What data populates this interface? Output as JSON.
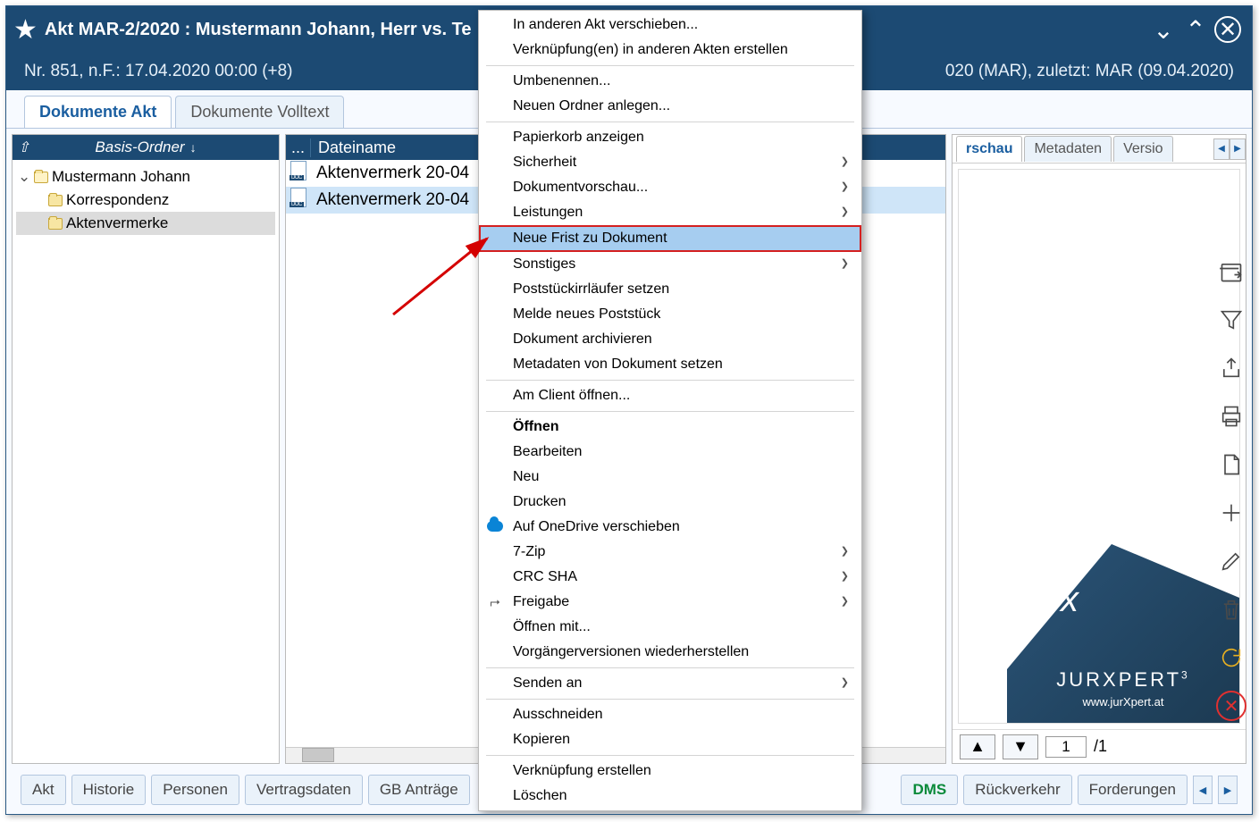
{
  "titlebar": {
    "title": "Akt MAR-2/2020 : Mustermann Johann, Herr vs. Te"
  },
  "subheader": {
    "left": "Nr. 851, n.F.: 17.04.2020 00:00 (+8)",
    "right": "020 (MAR), zuletzt: MAR (09.04.2020)"
  },
  "tabs": {
    "akt": "Dokumente Akt",
    "volltext": "Dokumente Volltext"
  },
  "leftpanel": {
    "pathlabel": "Basis-Ordner",
    "root": "Mustermann Johann",
    "child1": "Korrespondenz",
    "child2": "Aktenvermerke"
  },
  "filelist": {
    "header_dots": "...",
    "header_name": "Dateiname",
    "row1": "Aktenvermerk  20-04",
    "row2": "Aktenvermerk  20-04"
  },
  "preview_tabs": {
    "vorschau": "rschau",
    "metadaten": "Metadaten",
    "versio": "Versio"
  },
  "preview_logo": {
    "brand": "JURXPERT",
    "sup": "3",
    "url": "www.jurXpert.at"
  },
  "pager": {
    "page": "1",
    "of": "/1"
  },
  "bottom": {
    "akt": "Akt",
    "historie": "Historie",
    "personen": "Personen",
    "vertrag": "Vertragsdaten",
    "gb": "GB Anträge",
    "dms": "DMS",
    "ruck": "Rückverkehr",
    "ford": "Forderungen"
  },
  "ctx": {
    "move": "In anderen Akt verschieben...",
    "link": "Verknüpfung(en) in anderen Akten erstellen",
    "rename": "Umbenennen...",
    "newfolder": "Neuen Ordner anlegen...",
    "recycle": "Papierkorb anzeigen",
    "security": "Sicherheit",
    "docpreview": "Dokumentvorschau...",
    "leistungen": "Leistungen",
    "neuefrist": "Neue Frist zu Dokument",
    "sonstiges": "Sonstiges",
    "irrlauf": "Poststückirrläufer setzen",
    "melde": "Melde neues Poststück",
    "archiv": "Dokument archivieren",
    "metaset": "Metadaten von Dokument setzen",
    "clientopen": "Am Client öffnen...",
    "open": "Öffnen",
    "edit": "Bearbeiten",
    "new": "Neu",
    "print": "Drucken",
    "onedrive": "Auf OneDrive verschieben",
    "sevenzip": "7-Zip",
    "crc": "CRC SHA",
    "freigabe": "Freigabe",
    "openwith": "Öffnen mit...",
    "restore": "Vorgängerversionen wiederherstellen",
    "sendto": "Senden an",
    "cut": "Ausschneiden",
    "copy": "Kopieren",
    "shortcut": "Verknüpfung erstellen",
    "delete": "Löschen"
  }
}
